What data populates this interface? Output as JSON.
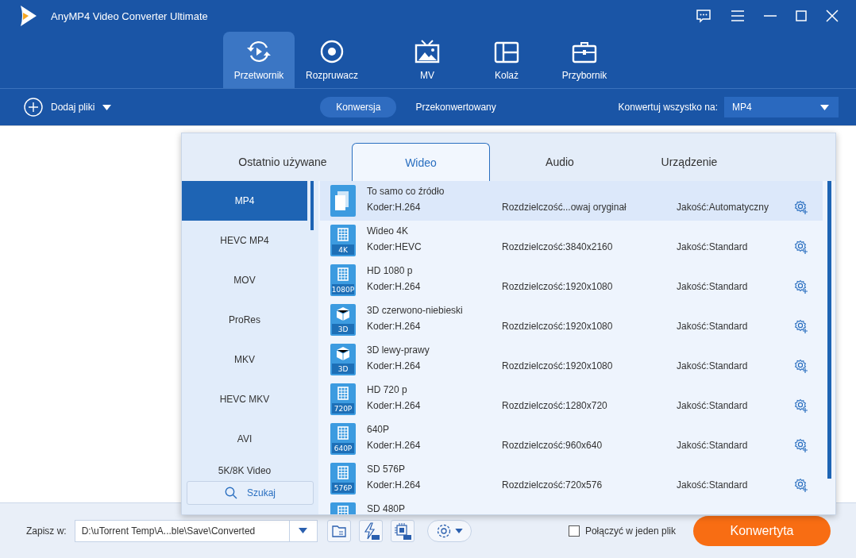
{
  "window": {
    "title": "AnyMP4 Video Converter Ultimate"
  },
  "nav_tabs": [
    {
      "label": "Przetwornik",
      "kind": "convert",
      "selected": true
    },
    {
      "label": "Rozpruwacz",
      "kind": "ripper",
      "selected": false
    },
    {
      "label": "MV",
      "kind": "mv",
      "selected": false
    },
    {
      "label": "Kolaż",
      "kind": "collage",
      "selected": false
    },
    {
      "label": "Przybornik",
      "kind": "toolbox",
      "selected": false
    }
  ],
  "toolbar": {
    "add_files": "Dodaj pliki",
    "modes": [
      {
        "label": "Konwersja",
        "selected": true
      },
      {
        "label": "Przekonwertowany",
        "selected": false
      }
    ],
    "convert_all_label": "Konwertuj wszystko na:",
    "convert_all_value": "MP4"
  },
  "format_panel": {
    "tabs": [
      {
        "label": "Ostatnio używane",
        "selected": false
      },
      {
        "label": "Wideo",
        "selected": true
      },
      {
        "label": "Audio",
        "selected": false
      },
      {
        "label": "Urządzenie",
        "selected": false
      }
    ],
    "categories": [
      {
        "label": "MP4",
        "selected": true
      },
      {
        "label": "HEVC MP4",
        "selected": false
      },
      {
        "label": "MOV",
        "selected": false
      },
      {
        "label": "ProRes",
        "selected": false
      },
      {
        "label": "MKV",
        "selected": false
      },
      {
        "label": "HEVC MKV",
        "selected": false
      },
      {
        "label": "AVI",
        "selected": false
      },
      {
        "label": "5K/8K Video",
        "selected": false
      }
    ],
    "search": "Szukaj",
    "presets": [
      {
        "name": "To samo co źródło",
        "kind": "same",
        "encoder": "Koder:H.264",
        "resolution": "Rozdzielczość...owaj oryginał",
        "quality": "Jakość:Automatyczny",
        "selected": true
      },
      {
        "name": "Wideo 4K",
        "kind": "film",
        "badge": "4K",
        "encoder": "Koder:HEVC",
        "resolution": "Rozdzielczość:3840x2160",
        "quality": "Jakość:Standard",
        "selected": false
      },
      {
        "name": "HD 1080 p",
        "kind": "film",
        "badge": "1080P",
        "encoder": "Koder:H.264",
        "resolution": "Rozdzielczość:1920x1080",
        "quality": "Jakość:Standard",
        "selected": false
      },
      {
        "name": "3D czerwono-niebieski",
        "kind": "cube",
        "badge": "3D",
        "encoder": "Koder:H.264",
        "resolution": "Rozdzielczość:1920x1080",
        "quality": "Jakość:Standard",
        "selected": false
      },
      {
        "name": "3D lewy-prawy",
        "kind": "cube",
        "badge": "3D",
        "encoder": "Koder:H.264",
        "resolution": "Rozdzielczość:1920x1080",
        "quality": "Jakość:Standard",
        "selected": false
      },
      {
        "name": "HD 720 p",
        "kind": "film",
        "badge": "720P",
        "encoder": "Koder:H.264",
        "resolution": "Rozdzielczość:1280x720",
        "quality": "Jakość:Standard",
        "selected": false
      },
      {
        "name": "640P",
        "kind": "film",
        "badge": "640P",
        "encoder": "Koder:H.264",
        "resolution": "Rozdzielczość:960x640",
        "quality": "Jakość:Standard",
        "selected": false
      },
      {
        "name": "SD 576P",
        "kind": "film",
        "badge": "576P",
        "encoder": "Koder:H.264",
        "resolution": "Rozdzielczość:720x576",
        "quality": "Jakość:Standard",
        "selected": false
      },
      {
        "name": "SD 480P",
        "kind": "film",
        "selected": false
      }
    ]
  },
  "bottom_bar": {
    "save_label": "Zapisz w:",
    "save_path": "D:\\uTorrent Temp\\A...ble\\Save\\Converted",
    "merge": {
      "label": "Połączyć w jeden plik",
      "checked": false
    },
    "convert_button": "Konwertyta"
  }
}
